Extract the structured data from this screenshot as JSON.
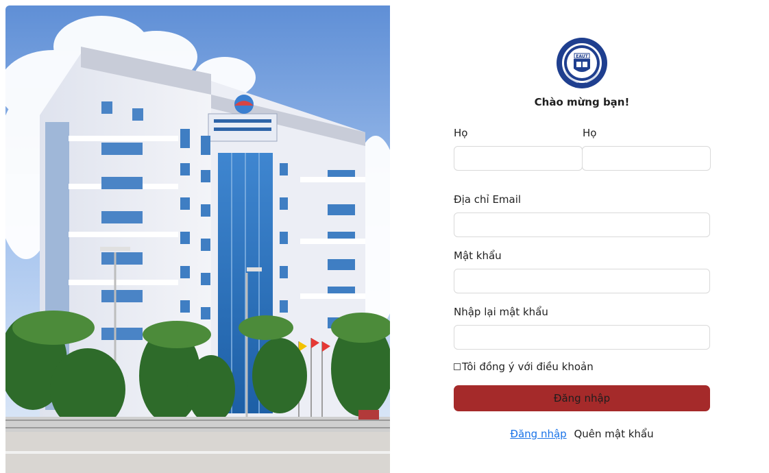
{
  "welcome": "Chào mừng bạn!",
  "logo": {
    "icon": "university-seal-icon",
    "text": "EAUT"
  },
  "form": {
    "first_name_label": "Họ",
    "last_name_label": "Họ",
    "email_label": "Địa chỉ Email",
    "password_label": "Mật khẩu",
    "confirm_password_label": "Nhập lại mật khẩu",
    "first_name_value": "",
    "last_name_value": "",
    "email_value": "",
    "password_value": "",
    "confirm_password_value": "",
    "terms_label": "Tôi đồng ý với điều khoản",
    "terms_checked": false,
    "submit_label": "Đăng nhập"
  },
  "links": {
    "login": "Đăng nhập",
    "forgot_password": "Quên mật khẩu"
  },
  "colors": {
    "primary": "#a52a2a",
    "link": "#1a73e8"
  }
}
